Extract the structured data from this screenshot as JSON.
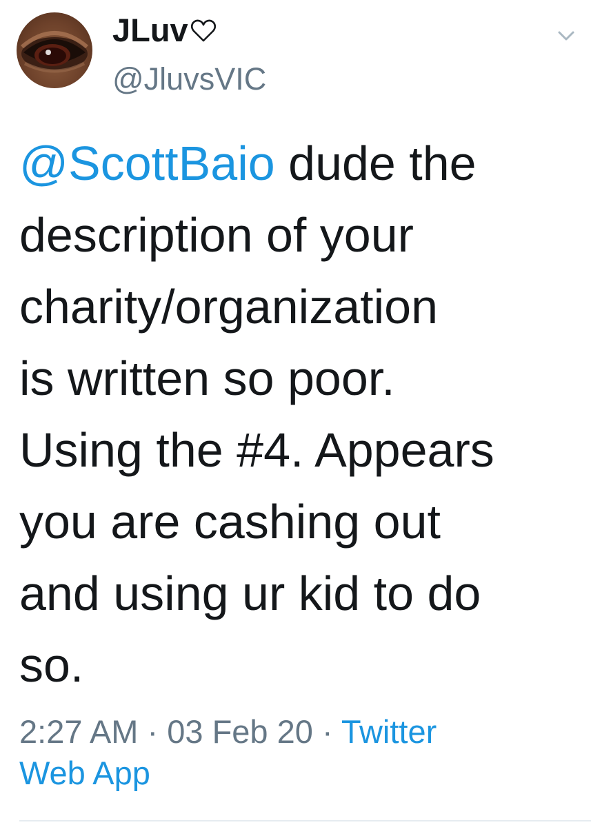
{
  "tweet": {
    "author": {
      "display_name": "JLuv",
      "handle": "@JluvsVIC",
      "avatar_icon": "eye-avatar",
      "name_icon": "heart-outline-icon"
    },
    "text": {
      "mention": "@ScottBaio",
      "line1_rest": " dude the",
      "line2": "description of your",
      "line3": "charity/organization",
      "line4": "is written so poor.",
      "line5": "Using the #4. Appears",
      "line6": "you are cashing out",
      "line7": "and using ur kid to do",
      "line8": "so."
    },
    "meta": {
      "time": "2:27 AM",
      "separator1": " · ",
      "date": "03 Feb 20",
      "separator2": " · ",
      "source_part1": "Twitter",
      "source_part2": "Web App"
    },
    "menu_icon": "chevron-down-icon"
  },
  "colors": {
    "text": "#14171a",
    "secondary": "#657786",
    "link": "#1b95e0",
    "divider": "#e6ecf0"
  }
}
